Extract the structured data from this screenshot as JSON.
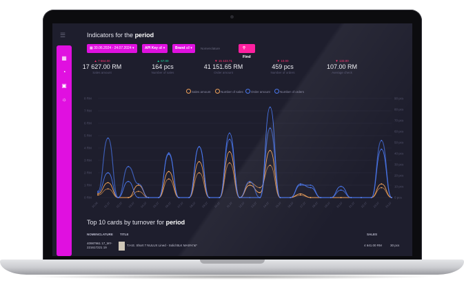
{
  "header": {
    "title_prefix": "Indicators for the",
    "title_bold": "period",
    "menu_icon": "list-icon"
  },
  "sidebar": {
    "icons": [
      "chart-icon",
      "pie-chart-icon",
      "image-icon",
      "bulb-icon"
    ]
  },
  "filters": {
    "date_range": "30.06.2024 - 24.07.2024",
    "api_key_label": "API Key",
    "api_key_value": "all",
    "brand_label": "Brand",
    "brand_value": "all",
    "nomenclature_placeholder": "Nomenclature",
    "find_label": "Find"
  },
  "kpis": [
    {
      "delta": "▲ 7 664.00",
      "value": "17 627.00 RM",
      "label": "Sales amount",
      "color": "#ff2d6f"
    },
    {
      "delta": "▲ 67.00",
      "value": "164 pcs",
      "label": "Number of sales",
      "color": "#18d49a"
    },
    {
      "delta": "▼ 15 423.71",
      "value": "41 151.65 RM",
      "label": "Order amount",
      "color": "#ff2d6f"
    },
    {
      "delta": "▼ 10.00",
      "value": "459 pcs",
      "label": "Number of orders",
      "color": "#ff2d6f"
    },
    {
      "delta": "▼ 133.00",
      "value": "107.00 RM",
      "label": "Average check",
      "color": "#ff2d6f"
    }
  ],
  "legend": [
    {
      "name": "Sales amount",
      "color": "#f2a35a"
    },
    {
      "name": "Number of sales",
      "color": "#f2a35a"
    },
    {
      "name": "Order amount",
      "color": "#4a78f0"
    },
    {
      "name": "Number of orders",
      "color": "#4a78f0"
    }
  ],
  "chart_data": {
    "type": "line",
    "x": [
      "30.06",
      "01.07",
      "02.07",
      "03.07",
      "04.07",
      "05.07",
      "06.07",
      "07.07",
      "08.07",
      "09.07",
      "10.07",
      "11.07",
      "12.07",
      "13.07",
      "14.07",
      "15.07",
      "16.07",
      "17.07",
      "18.07",
      "19.07",
      "20.07",
      "21.07",
      "22.07",
      "23.07",
      "24.07"
    ],
    "y_left_ticks": [
      "0 RM",
      "1 RM",
      "2 RM",
      "3 RM",
      "4 RM",
      "5 RM",
      "6 RM",
      "7 RM",
      "8 RM"
    ],
    "y_right_ticks": [
      "0 pcs",
      "10 pcs",
      "20 pcs",
      "30 pcs",
      "40 pcs",
      "50 pcs",
      "60 pcs",
      "70 pcs",
      "80 pcs",
      "90 pcs"
    ],
    "ylim": [
      0,
      8
    ],
    "series": [
      {
        "name": "Sales amount",
        "color": "#f2a35a",
        "values": [
          0.3,
          1.2,
          0,
          0,
          1.0,
          0,
          0,
          2.1,
          0,
          0,
          2.9,
          0,
          0,
          3.7,
          0,
          1.0,
          0.4,
          3.8,
          0,
          0,
          0.3,
          0,
          0,
          0,
          0,
          0,
          0,
          0,
          1.1,
          0
        ]
      },
      {
        "name": "Number of sales",
        "color": "#f2a35a",
        "values": [
          0.2,
          0.7,
          0,
          0,
          0.5,
          0,
          0,
          1.5,
          0,
          0,
          2.0,
          0,
          0,
          2.8,
          0,
          1.2,
          0.8,
          2.6,
          0,
          0,
          0.2,
          0,
          0,
          0,
          0,
          0,
          0,
          0,
          0.8,
          0
        ]
      },
      {
        "name": "Order amount",
        "color": "#4a78f0",
        "values": [
          0.4,
          2.0,
          0,
          1.3,
          0,
          0,
          0,
          3.5,
          0,
          0,
          4.1,
          0,
          0,
          5.2,
          0,
          0,
          0,
          7.3,
          0,
          0,
          1.1,
          0.8,
          0,
          0,
          0.9,
          0,
          0,
          0,
          3.9,
          0
        ]
      },
      {
        "name": "Number of orders",
        "color": "#4a78f0",
        "values": [
          0.5,
          4.8,
          0,
          2.5,
          1.1,
          0,
          0,
          3.6,
          0,
          0,
          4.1,
          0,
          0,
          4.7,
          0,
          1.3,
          0,
          5.6,
          0,
          0,
          1.0,
          1.0,
          0,
          0,
          0.6,
          0,
          0,
          0,
          4.6,
          0
        ]
      }
    ]
  },
  "top": {
    "title_prefix": "Top 10 cards by turnover for",
    "title_bold": "period",
    "col_nomenclature": "NOMENCLATURE",
    "col_title": "TITLE",
    "col_sales": "SALES",
    "rows": [
      {
        "nomenclature": "40987961 17_MY-221617221 19",
        "title": "T.H.E. Short 7 NULUX Lined - Solid BLK MAS%\"&*",
        "sales_amount": "4 641.00 RM",
        "sales_count": "30 pcs"
      }
    ]
  }
}
